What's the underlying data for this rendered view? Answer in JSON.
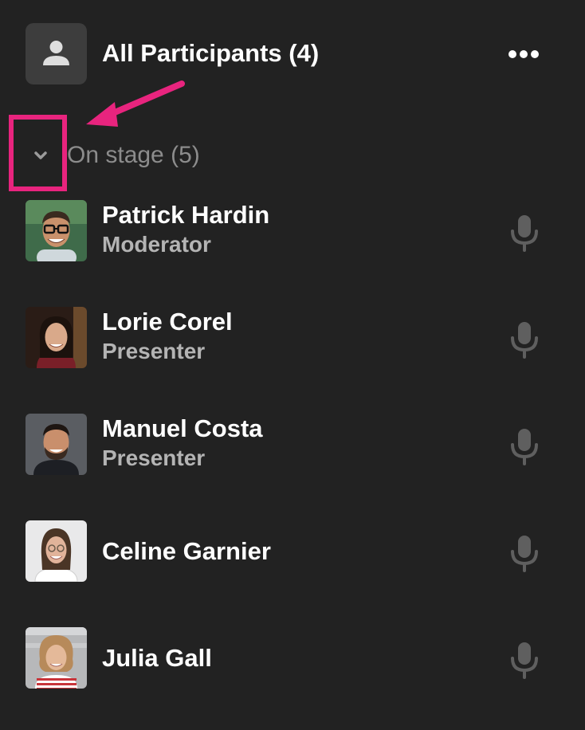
{
  "header": {
    "title": "All Participants (4)",
    "avatar_icon": "user-icon",
    "more_icon": "more-horizontal-icon"
  },
  "section": {
    "title": "On stage (5)",
    "toggle_icon": "chevron-down-icon",
    "expanded": true
  },
  "annotation": {
    "color": "#e8247e"
  },
  "participants": [
    {
      "name": "Patrick Hardin",
      "role": "Moderator",
      "mic_icon": "microphone-icon"
    },
    {
      "name": "Lorie Corel",
      "role": "Presenter",
      "mic_icon": "microphone-icon"
    },
    {
      "name": "Manuel Costa",
      "role": "Presenter",
      "mic_icon": "microphone-icon"
    },
    {
      "name": "Celine Garnier",
      "role": "",
      "mic_icon": "microphone-icon"
    },
    {
      "name": "Julia Gall",
      "role": "",
      "mic_icon": "microphone-icon"
    }
  ],
  "colors": {
    "background": "#222222",
    "text_primary": "#ffffff",
    "text_secondary": "#b4b4b4",
    "section_text": "#8c8c8c",
    "icon_muted": "#5f5f5f"
  }
}
